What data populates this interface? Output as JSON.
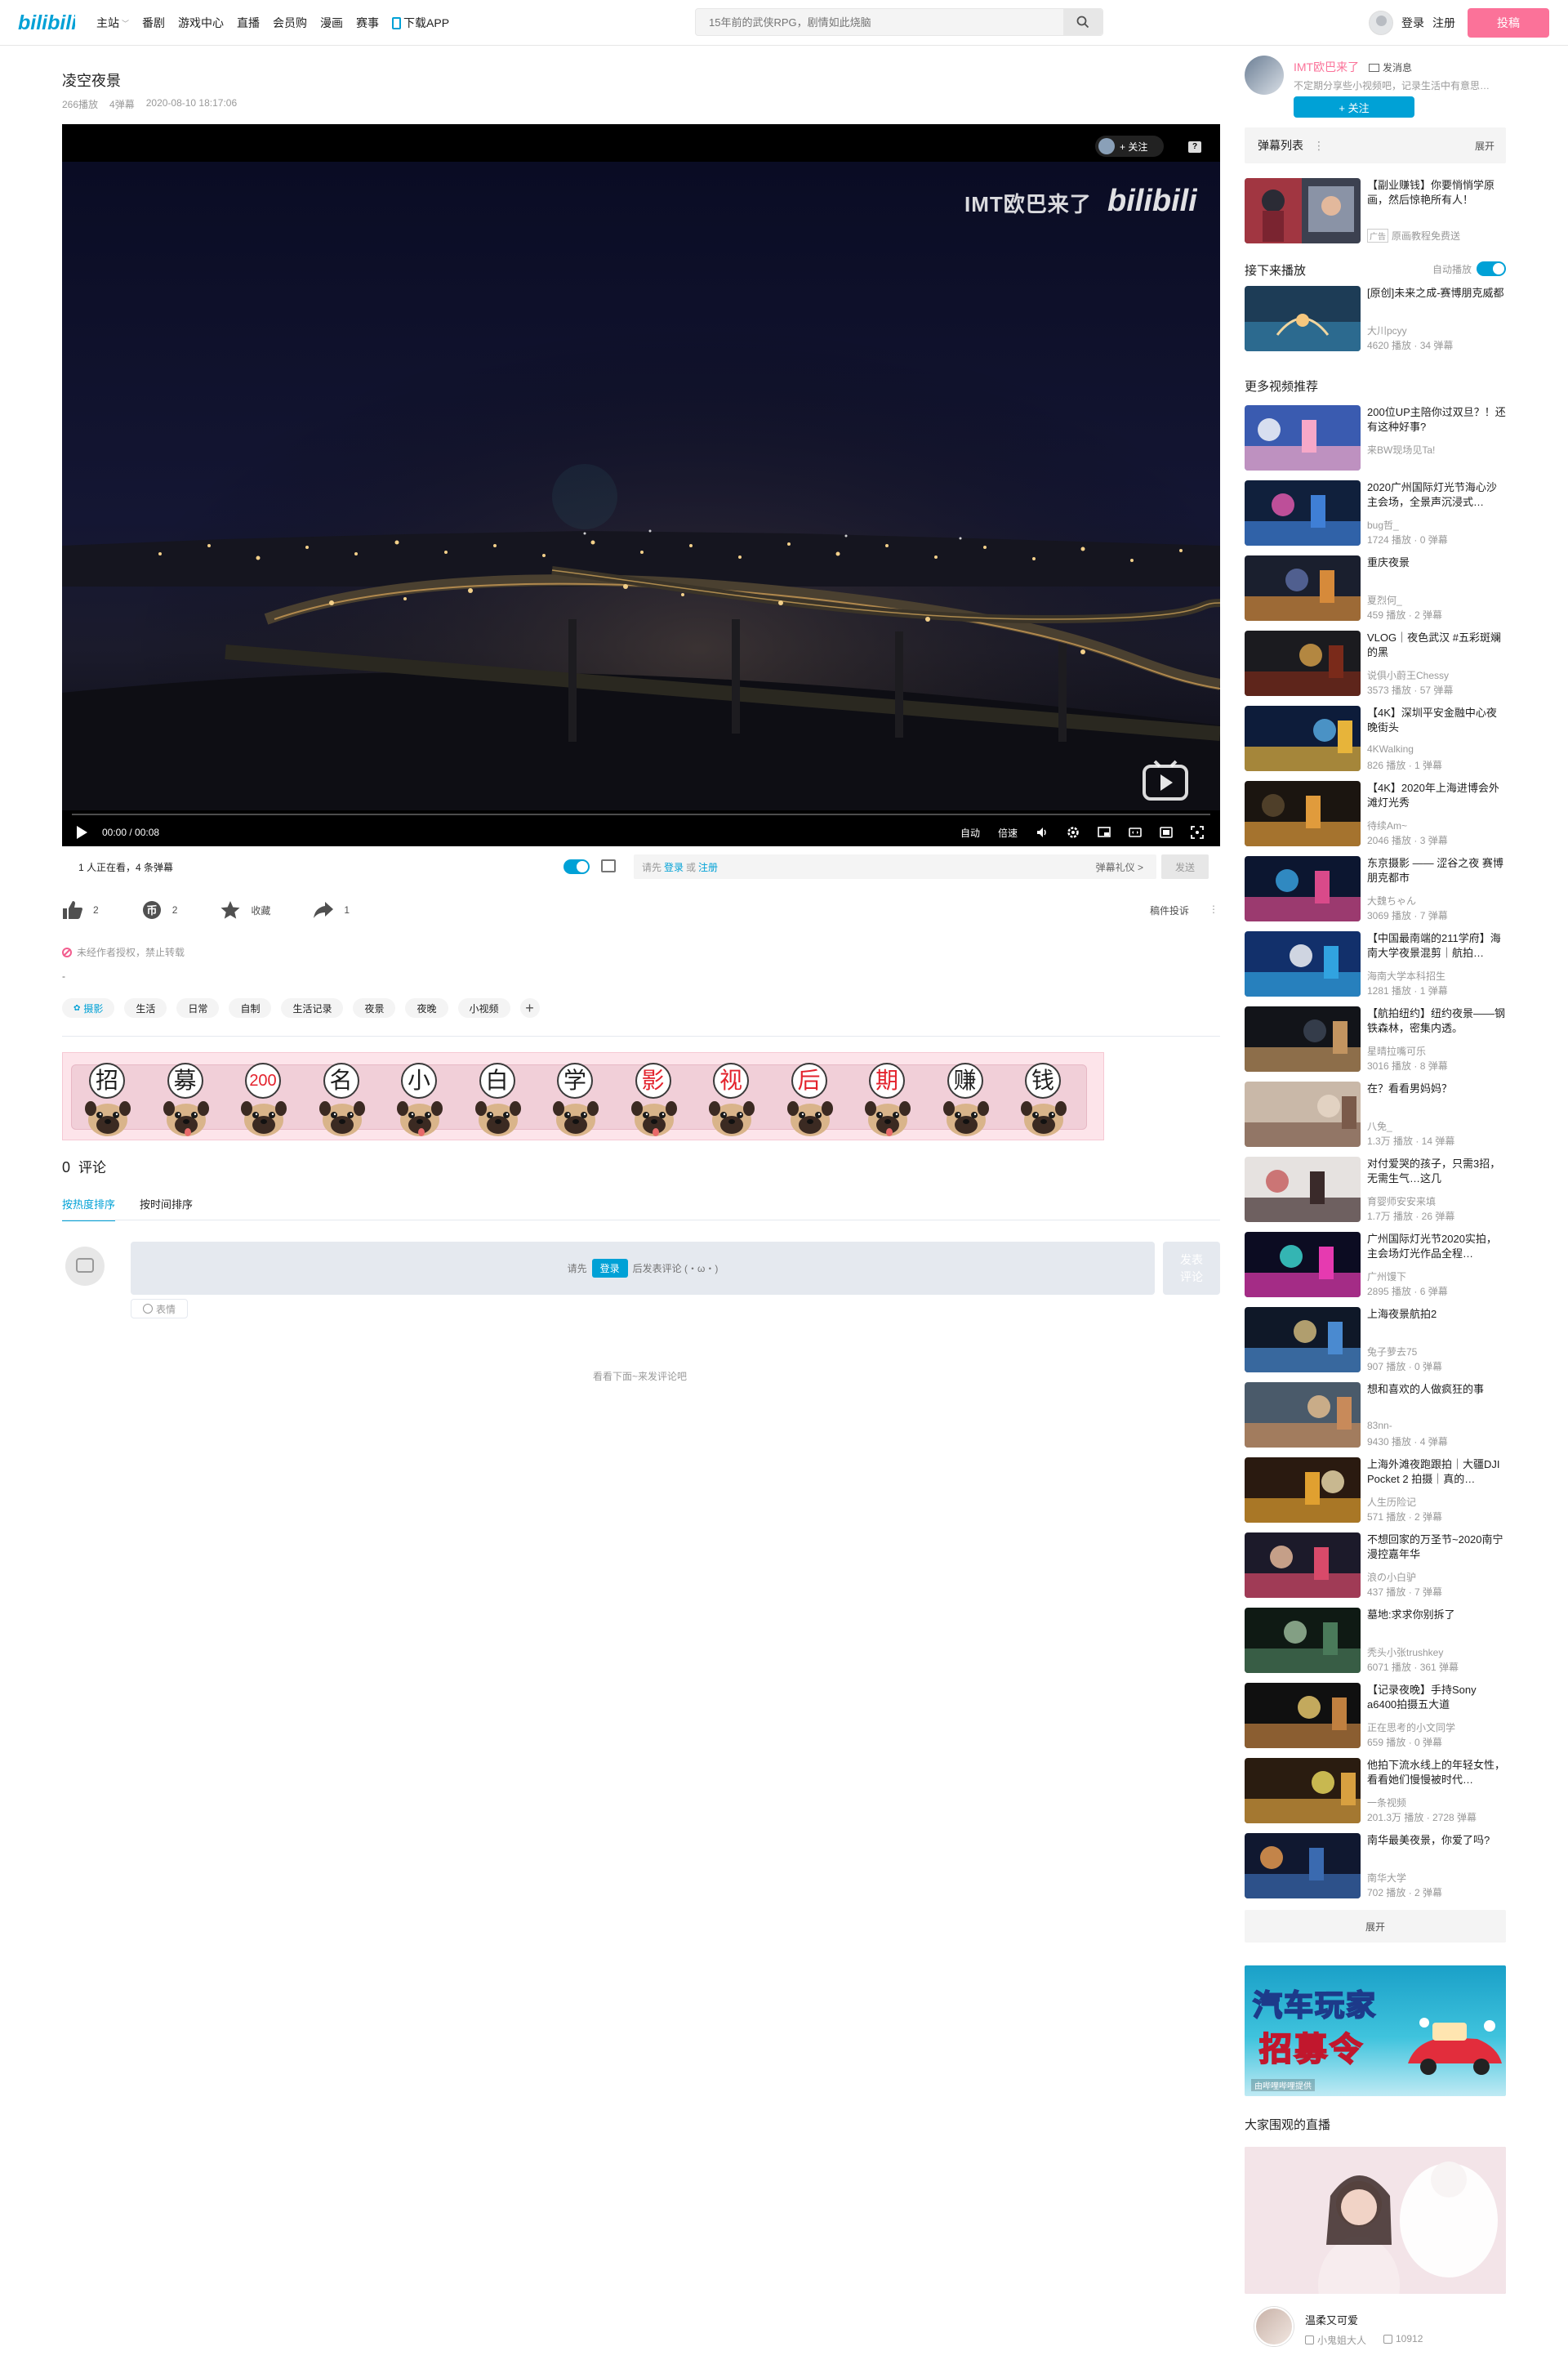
{
  "header": {
    "nav": [
      {
        "label": "主站",
        "has_dropdown": true
      },
      {
        "label": "番剧"
      },
      {
        "label": "游戏中心"
      },
      {
        "label": "直播"
      },
      {
        "label": "会员购"
      },
      {
        "label": "漫画"
      },
      {
        "label": "赛事"
      },
      {
        "label": "下载APP",
        "icon": "phone-icon"
      }
    ],
    "search_placeholder": "15年前的武侠RPG，剧情如此烧脑",
    "login": "登录",
    "register": "注册",
    "upload": "投稿"
  },
  "video": {
    "title": "凌空夜景",
    "plays": "266播放",
    "danmaku": "4弹幕",
    "date": "2020-08-10 18:17:06"
  },
  "player": {
    "follow_label": "+ 关注",
    "help": "?",
    "watermark": "IMT欧巴来了",
    "time": "00:00 / 00:08",
    "controls": [
      "自动",
      "倍速"
    ]
  },
  "danmaku_bar": {
    "viewers": "1 人正在看，4 条弹幕",
    "prompt_prefix": "请先",
    "login": "登录",
    "or": "或",
    "register": "注册",
    "etiquette": "弹幕礼仪 >",
    "send": "发送"
  },
  "actions": {
    "like": "2",
    "coin": "2",
    "favorite": "收藏",
    "share": "1",
    "report": "稿件投诉"
  },
  "notice": "未经作者授权，禁止转载",
  "description": "-",
  "tags": [
    "摄影",
    "生活",
    "日常",
    "自制",
    "生活记录",
    "夜景",
    "夜晚",
    "小视频"
  ],
  "banner": {
    "chars": [
      "招",
      "募",
      "200",
      "名",
      "小",
      "白",
      "学",
      "影",
      "视",
      "后",
      "期",
      "赚",
      "钱"
    ],
    "red_indices": [
      2,
      7,
      8,
      9,
      10
    ]
  },
  "comments": {
    "count": "0",
    "label": "评论",
    "tabs": [
      "按热度排序",
      "按时间排序"
    ],
    "prompt_prefix": "请先",
    "login": "登录",
    "prompt_suffix": "后发表评论 (・ω・)",
    "send": "发表\n评论",
    "emoji": "表情",
    "empty": "看看下面~来发评论吧"
  },
  "up": {
    "name": "IMT欧巴来了",
    "message": "发消息",
    "desc": "不定期分享些小视频吧，记录生活中有意思的事",
    "follow": "+ 关注"
  },
  "danmaku_list": {
    "title": "弹幕列表",
    "expand": "展开"
  },
  "ad_card": {
    "title": "【副业赚钱】你要悄悄学原画，然后惊艳所有人！",
    "badge": "广告",
    "sub": "原画教程免费送"
  },
  "next_up": {
    "title": "接下来播放",
    "autoplay": "自动播放",
    "item": {
      "title": "[原创]未来之成-赛博朋克威都",
      "up": "大川pcyy",
      "stats": "4620 播放 · 34 弹幕"
    }
  },
  "recommend": {
    "title": "更多视频推荐",
    "items": [
      {
        "title": "200位UP主陪你过双旦？！还有这种好事?",
        "up": "来BW现场见Ta!",
        "stats": ""
      },
      {
        "title": "2020广州国际灯光节海心沙主会场，全景声沉浸式…",
        "up": "bug哲_",
        "stats": "1724 播放 · 0 弹幕"
      },
      {
        "title": "重庆夜景",
        "up": "夏烈何_",
        "stats": "459 播放 · 2 弹幕"
      },
      {
        "title": "VLOG｜夜色武汉 #五彩斑斓的黑",
        "up": "说俱小蔚王Chessy",
        "stats": "3573 播放 · 57 弹幕"
      },
      {
        "title": "【4K】深圳平安金融中心夜晚街头",
        "up": "4KWalking",
        "stats": "826 播放 · 1 弹幕"
      },
      {
        "title": "【4K】2020年上海进博会外滩灯光秀",
        "up": "待续Am~",
        "stats": "2046 播放 · 3 弹幕"
      },
      {
        "title": "东京摄影 —— 涩谷之夜 赛博朋克都市",
        "up": "大魏ちゃん",
        "stats": "3069 播放 · 7 弹幕"
      },
      {
        "title": "【中国最南端的211学府】海南大学夜景混剪｜航拍…",
        "up": "海南大学本科招生",
        "stats": "1281 播放 · 1 弹幕"
      },
      {
        "title": "【航拍纽约】纽约夜景——钢铁森林，密集内透。",
        "up": "星晴拉嘴可乐",
        "stats": "3016 播放 · 8 弹幕"
      },
      {
        "title": "在？看看男妈妈？",
        "up": "八免_",
        "stats": "1.3万 播放 · 14 弹幕"
      },
      {
        "title": "对付爱哭的孩子，只需3招，无需生气…这几",
        "up": "育婴师安安来填",
        "stats": "1.7万 播放 · 26 弹幕"
      },
      {
        "title": "广州国际灯光节2020实拍，主会场灯光作品全程…",
        "up": "广州馒下",
        "stats": "2895 播放 · 6 弹幕"
      },
      {
        "title": "上海夜景航拍2",
        "up": "兔子萝去75",
        "stats": "907 播放 · 0 弹幕"
      },
      {
        "title": "想和喜欢的人做疯狂的事",
        "up": "83nn-",
        "stats": "9430 播放 · 4 弹幕"
      },
      {
        "title": "上海外滩夜跑跟拍｜大疆DJI Pocket 2 拍摄｜真的…",
        "up": "人生历险记",
        "stats": "571 播放 · 2 弹幕"
      },
      {
        "title": "不想回家的万圣节~2020南宁漫控嘉年华",
        "up": "浪の小白驴",
        "stats": "437 播放 · 7 弹幕"
      },
      {
        "title": "墓地:求求你别拆了",
        "up": "秃头小张trushkey",
        "stats": "6071 播放 · 361 弹幕"
      },
      {
        "title": "【记录夜晚】手持Sony a6400拍摄五大道",
        "up": "正在思考的小文同学",
        "stats": "659 播放 · 0 弹幕"
      },
      {
        "title": "他拍下流水线上的年轻女性，看看她们慢慢被时代…",
        "up": "一条视频",
        "stats": "201.3万 播放 · 2728 弹幕"
      },
      {
        "title": "南华最美夜景，你爱了吗?",
        "up": "南华大学",
        "stats": "702 播放 · 2 弹幕"
      }
    ],
    "more": "展开"
  },
  "ad_banner": {
    "line1": "汽车玩家",
    "line2": "招募令",
    "tag": "由哔哩哔哩提供"
  },
  "live": {
    "title": "大家围观的直播",
    "name": "温柔又可爱",
    "up": "小鬼姐大人",
    "count": "10912"
  }
}
